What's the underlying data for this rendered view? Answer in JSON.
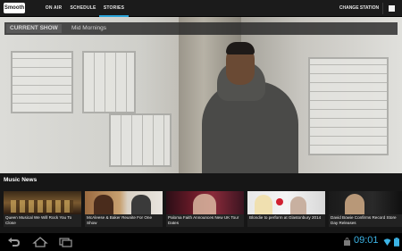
{
  "app": {
    "logo_text": "Smooth"
  },
  "tabs": [
    {
      "label": "ON AIR",
      "active": false
    },
    {
      "label": "SCHEDULE",
      "active": false
    },
    {
      "label": "STORIES",
      "active": true
    }
  ],
  "actions": {
    "change_station": "CHANGE STATION"
  },
  "current": {
    "label": "CURRENT SHOW",
    "show": "Mid Mornings"
  },
  "news": {
    "title": "Music News",
    "items": [
      {
        "caption": "Queen Musical We Will Rock You To Close"
      },
      {
        "caption": "McAleese & Baker Reunite For One Show"
      },
      {
        "caption": "Paloma Faith Announces New UK Tour Dates"
      },
      {
        "caption": "Blondie to perform at Glastonbury 2014"
      },
      {
        "caption": "David Bowie Confirms Record Store Day Releases"
      }
    ]
  },
  "status": {
    "time": "09:01"
  },
  "colors": {
    "accent": "#2aa3d8",
    "clock": "#3cb4e6",
    "bar": "#1b1b1b"
  }
}
